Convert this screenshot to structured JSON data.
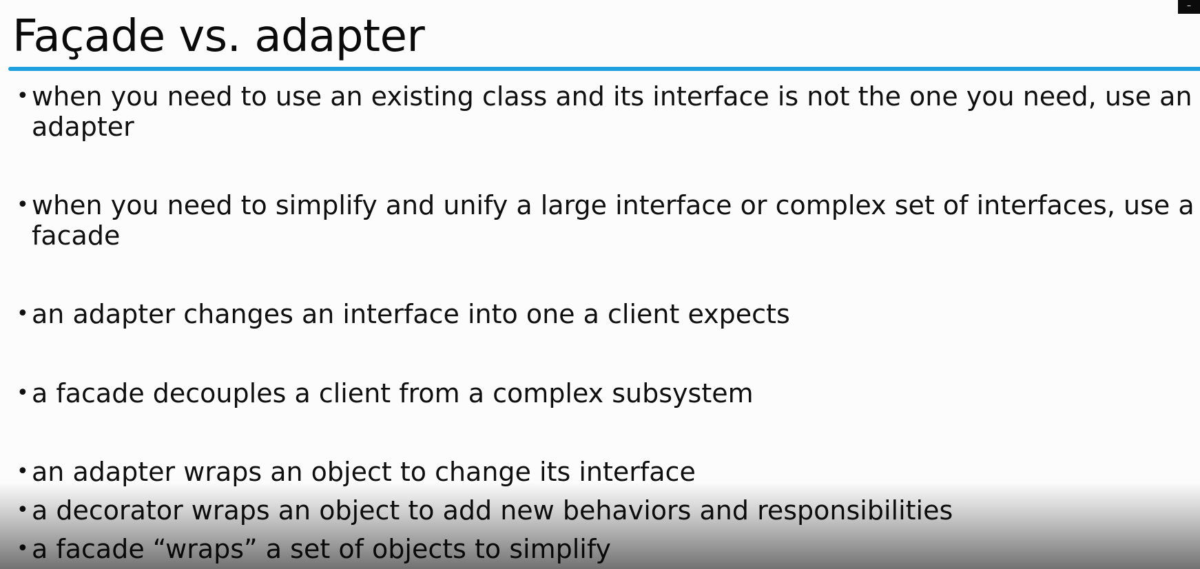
{
  "slide": {
    "title": "Façade vs. adapter",
    "bullet_char": "•",
    "bullets": [
      {
        "line1": "when you need to use an existing class and its interface is not the one you need, use an",
        "line2": "adapter"
      },
      {
        "line1": "when you need to simplify and unify a large interface or complex set of interfaces, use a",
        "line2": "facade"
      },
      {
        "line1": "an adapter changes an interface into one a client expects"
      },
      {
        "line1": "a facade decouples a client from a complex subsystem"
      },
      {
        "line1": "an adapter wraps an object to change its interface"
      },
      {
        "line1": "a decorator wraps an object to add new behaviors and responsibilities"
      },
      {
        "line1": "a facade “wraps” a set of objects to simplify"
      }
    ]
  },
  "corner_control": {
    "icon": "minimize-icon",
    "glyph": "–"
  },
  "colors": {
    "accent_rule": "#1fa0de",
    "text": "#0f0f0f",
    "background": "#fcfcfc"
  }
}
